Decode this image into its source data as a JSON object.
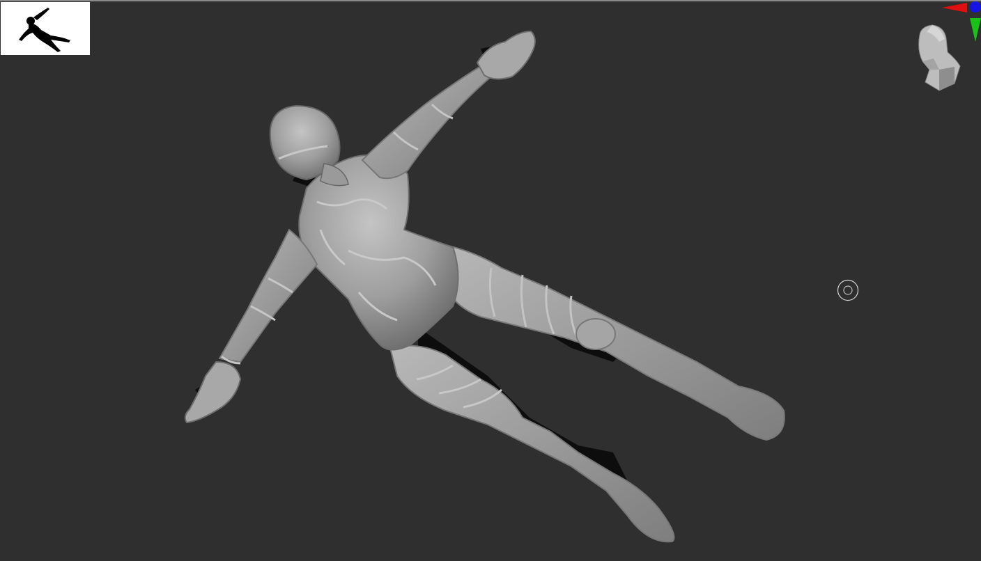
{
  "app": {
    "viewport_background": "#2f2f2f",
    "model_color": "#9b9b9b"
  },
  "thumbnail": {
    "icon": "figure-silhouette-icon",
    "background": "#ffffff"
  },
  "gizmo": {
    "icon": "orientation-head-icon",
    "axes": [
      {
        "name": "x-axis",
        "color": "#e01010"
      },
      {
        "name": "y-axis",
        "color": "#19c219"
      },
      {
        "name": "z-axis",
        "color": "#1414e6"
      }
    ]
  },
  "cursor": {
    "icon": "brush-cursor-icon"
  }
}
